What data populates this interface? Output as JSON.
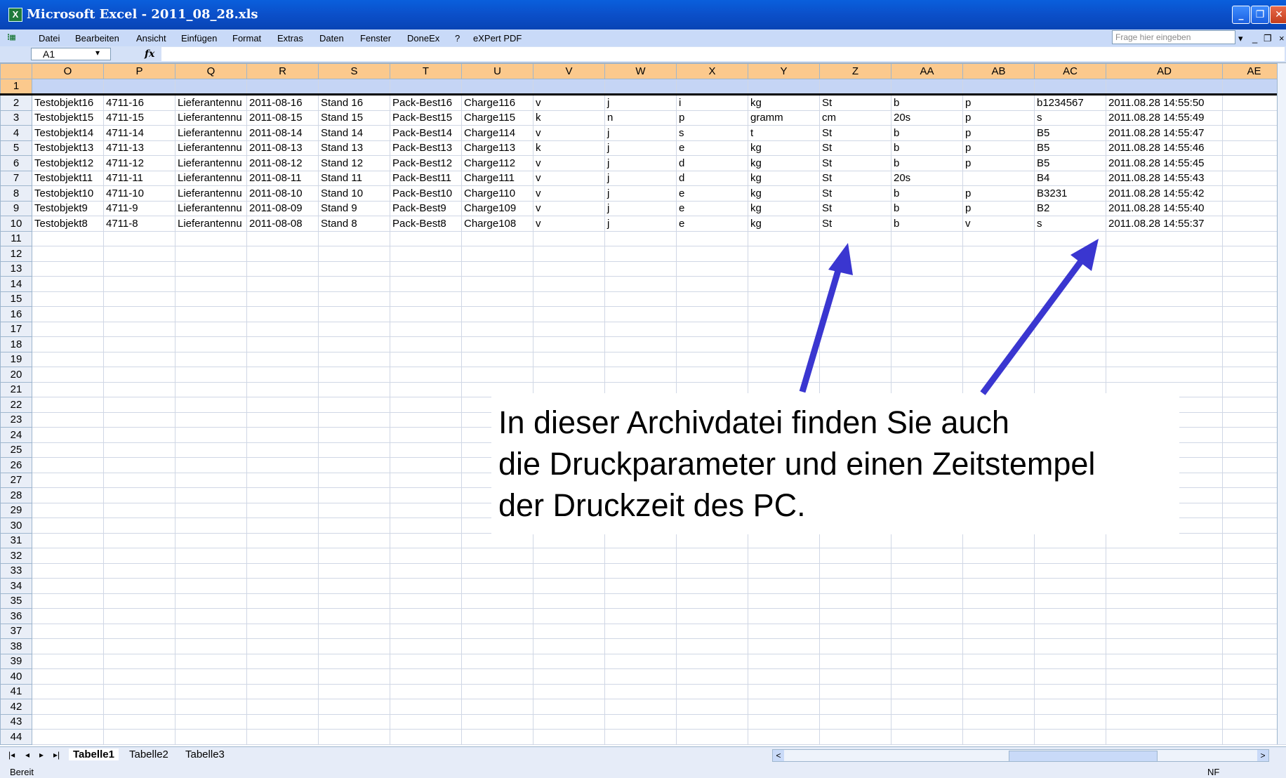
{
  "window": {
    "title": "Microsoft Excel - 2011_08_28.xls"
  },
  "menu": {
    "items": [
      "Datei",
      "Bearbeiten",
      "Ansicht",
      "Einfügen",
      "Format",
      "Extras",
      "Daten",
      "Fenster",
      "DoneEx",
      "?",
      "eXPert PDF"
    ],
    "help_placeholder": "Frage hier eingeben"
  },
  "formula": {
    "namebox": "A1",
    "fx": "fx",
    "content": ""
  },
  "columns": [
    "O",
    "P",
    "Q",
    "R",
    "S",
    "T",
    "U",
    "V",
    "W",
    "X",
    "Y",
    "Z",
    "AA",
    "AB",
    "AC",
    "AD",
    "AE"
  ],
  "rows": [
    [
      "Testobjekt16",
      "4711-16",
      "Lieferantennu",
      "2011-08-16",
      "Stand  16",
      "Pack-Best16",
      "Charge116",
      "v",
      "j",
      "i",
      "kg",
      "St",
      "b",
      "p",
      "b1234567",
      "2011.08.28  14:55:50",
      ""
    ],
    [
      "Testobjekt15",
      "4711-15",
      "Lieferantennu",
      "2011-08-15",
      "Stand  15",
      "Pack-Best15",
      "Charge115",
      "k",
      "n",
      "p",
      "gramm",
      "cm",
      "20s",
      "p",
      "s",
      "2011.08.28  14:55:49",
      ""
    ],
    [
      "Testobjekt14",
      "4711-14",
      "Lieferantennu",
      "2011-08-14",
      "Stand  14",
      "Pack-Best14",
      "Charge114",
      "v",
      "j",
      "s",
      "t",
      "St",
      "b",
      "p",
      "B5",
      "2011.08.28  14:55:47",
      ""
    ],
    [
      "Testobjekt13",
      "4711-13",
      "Lieferantennu",
      "2011-08-13",
      "Stand  13",
      "Pack-Best13",
      "Charge113",
      "k",
      "j",
      "e",
      "kg",
      "St",
      "b",
      "p",
      "B5",
      "2011.08.28  14:55:46",
      ""
    ],
    [
      "Testobjekt12",
      "4711-12",
      "Lieferantennu",
      "2011-08-12",
      "Stand  12",
      "Pack-Best12",
      "Charge112",
      "v",
      "j",
      "d",
      "kg",
      "St",
      "b",
      "p",
      "B5",
      "2011.08.28  14:55:45",
      ""
    ],
    [
      "Testobjekt11",
      "4711-11",
      "Lieferantennu",
      "2011-08-11",
      "Stand  11",
      "Pack-Best11",
      "Charge111",
      "v",
      "j",
      "d",
      "kg",
      "St",
      "20s",
      "",
      "B4",
      "2011.08.28  14:55:43",
      ""
    ],
    [
      "Testobjekt10",
      "4711-10",
      "Lieferantennu",
      "2011-08-10",
      "Stand  10",
      "Pack-Best10",
      "Charge110",
      "v",
      "j",
      "e",
      "kg",
      "St",
      "b",
      "p",
      "B3231",
      "2011.08.28  14:55:42",
      ""
    ],
    [
      "Testobjekt9",
      "4711-9",
      "Lieferantennu",
      "2011-08-09",
      "Stand  9",
      "Pack-Best9",
      "Charge109",
      "v",
      "j",
      "e",
      "kg",
      "St",
      "b",
      "p",
      "B2",
      "2011.08.28  14:55:40",
      ""
    ],
    [
      "Testobjekt8",
      "4711-8",
      "Lieferantennu",
      "2011-08-08",
      "Stand  8",
      "Pack-Best8",
      "Charge108",
      "v",
      "j",
      "e",
      "kg",
      "St",
      "b",
      "v",
      "s",
      "2011.08.28  14:55:37",
      ""
    ]
  ],
  "row_count": 44,
  "sheet_tabs": [
    "Tabelle1",
    "Tabelle2",
    "Tabelle3"
  ],
  "active_tab": "Tabelle1",
  "status": {
    "text": "Bereit",
    "indicator": "NF"
  },
  "annotation": {
    "lines": [
      "In dieser Archivdatei finden Sie auch",
      "die Druckparameter und einen Zeitstempel",
      "der Druckzeit des PC."
    ]
  },
  "colors": {
    "arrow": "#3a36d0",
    "header": "#fbc98d",
    "titlebar": "#0b4fc9"
  }
}
